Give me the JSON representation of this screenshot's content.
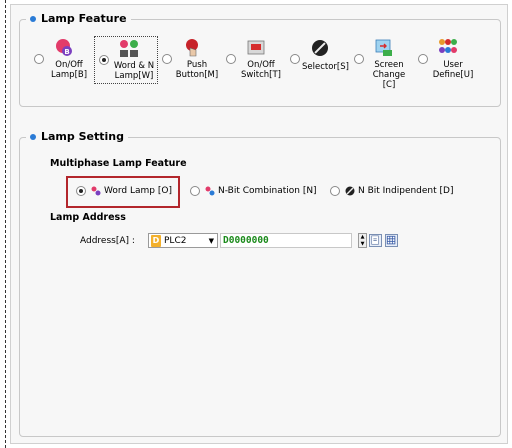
{
  "lamp_feature": {
    "title": "Lamp Feature",
    "options": [
      {
        "label_line1": "On/Off",
        "label_line2": "Lamp[B]",
        "icon": "bulb-b-icon",
        "selected": false
      },
      {
        "label_line1": "Word & N",
        "label_line2": "Lamp[W]",
        "icon": "word-lamp-icon",
        "selected": true
      },
      {
        "label_line1": "Push",
        "label_line2": "Button[M]",
        "icon": "push-button-icon",
        "selected": false
      },
      {
        "label_line1": "On/Off",
        "label_line2": "Switch[T]",
        "icon": "switch-icon",
        "selected": false
      },
      {
        "label_line1": "Selector[S]",
        "label_line2": "",
        "icon": "selector-knob-icon",
        "selected": false
      },
      {
        "label_line1": "Screen",
        "label_line2": "Change [C]",
        "icon": "screen-change-icon",
        "selected": false
      },
      {
        "label_line1": "User",
        "label_line2": "Define[U]",
        "icon": "user-define-icon",
        "selected": false
      }
    ]
  },
  "lamp_setting": {
    "title": "Lamp Setting",
    "multiphase_title": "Multiphase Lamp Feature",
    "multiphase_options": [
      {
        "label": "Word Lamp [O]",
        "icon": "word-lamp-icon",
        "selected": true
      },
      {
        "label": "N-Bit Combination [N]",
        "icon": "nbit-combination-icon",
        "selected": false
      },
      {
        "label": "N Bit Indipendent [D]",
        "icon": "nbit-independent-icon",
        "selected": false
      }
    ],
    "address_title": "Lamp Address",
    "address_label": "Address[A] :",
    "plc_badge": "D",
    "plc_value": "PLC2",
    "address_value": "D0000000"
  },
  "colors": {
    "accent_bullet": "#2a7bd6",
    "highlight_box": "#b3262c",
    "address_text": "#1a8a1a",
    "plc_badge": "#f3b02c"
  }
}
